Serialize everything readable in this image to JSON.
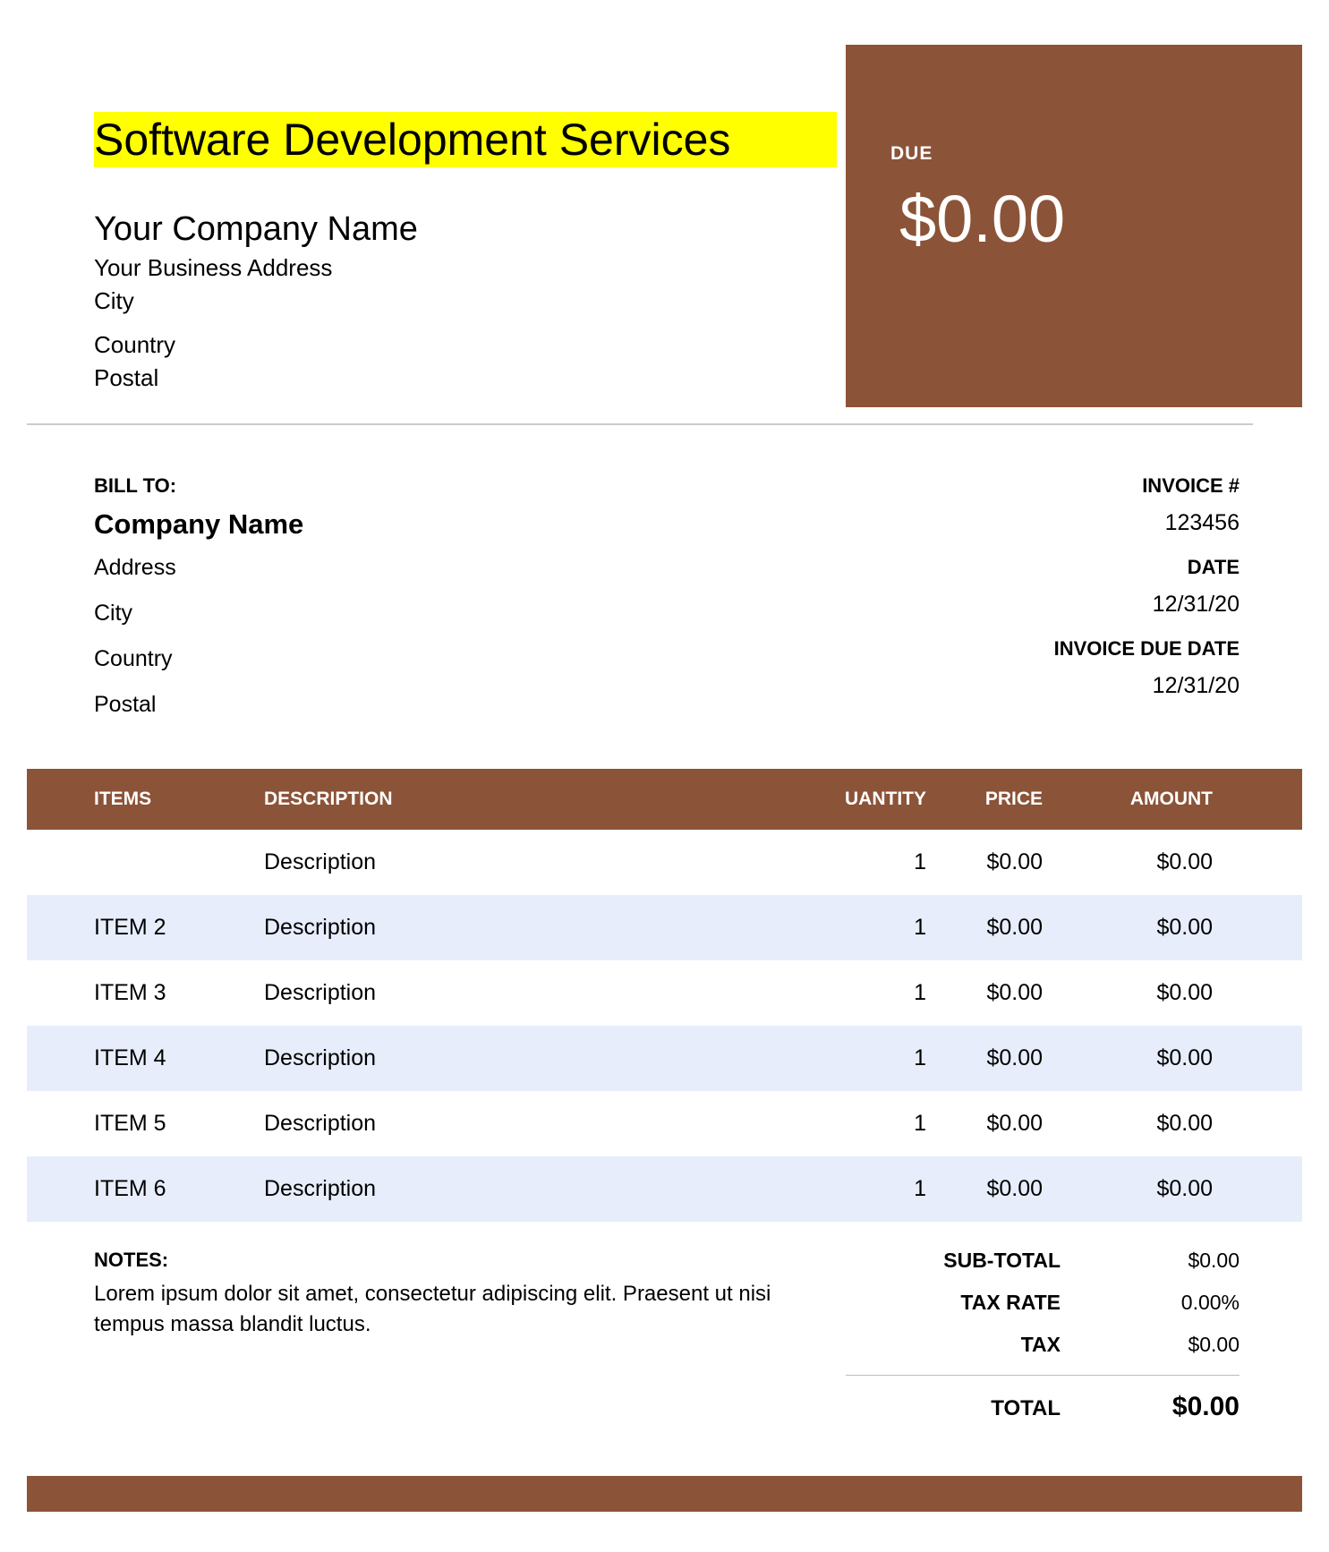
{
  "title": "Software Development Services",
  "company": {
    "name": "Your Company Name",
    "address": "Your Business Address",
    "city": "City",
    "country": "Country",
    "postal": "Postal"
  },
  "due": {
    "label": "DUE",
    "amount": "$0.00"
  },
  "bill_to": {
    "label": "BILL TO:",
    "company": "Company Name",
    "address": "Address",
    "city": "City",
    "country": "Country",
    "postal": "Postal"
  },
  "invoice_meta": {
    "number_label": "INVOICE #",
    "number": "123456",
    "date_label": "DATE",
    "date": "12/31/20",
    "due_date_label": "INVOICE DUE DATE",
    "due_date": "12/31/20"
  },
  "columns": {
    "items": "ITEMS",
    "description": "DESCRIPTION",
    "quantity": "UANTITY",
    "price": "PRICE",
    "amount": "AMOUNT"
  },
  "line_items": [
    {
      "item": "",
      "description": "Description",
      "qty": "1",
      "price": "$0.00",
      "amount": "$0.00"
    },
    {
      "item": "ITEM 2",
      "description": "Description",
      "qty": "1",
      "price": "$0.00",
      "amount": "$0.00"
    },
    {
      "item": "ITEM 3",
      "description": "Description",
      "qty": "1",
      "price": "$0.00",
      "amount": "$0.00"
    },
    {
      "item": "ITEM 4",
      "description": "Description",
      "qty": "1",
      "price": "$0.00",
      "amount": "$0.00"
    },
    {
      "item": "ITEM 5",
      "description": "Description",
      "qty": "1",
      "price": "$0.00",
      "amount": "$0.00"
    },
    {
      "item": "ITEM 6",
      "description": "Description",
      "qty": "1",
      "price": "$0.00",
      "amount": "$0.00"
    }
  ],
  "notes": {
    "label": "NOTES:",
    "text": "Lorem ipsum dolor sit amet, consectetur adipiscing elit. Praesent ut nisi tempus massa blandit luctus."
  },
  "totals": {
    "subtotal_label": "SUB-TOTAL",
    "subtotal": "$0.00",
    "tax_rate_label": "TAX RATE",
    "tax_rate": "0.00%",
    "tax_label": "TAX",
    "tax": "$0.00",
    "total_label": "TOTAL",
    "total": "$0.00"
  }
}
